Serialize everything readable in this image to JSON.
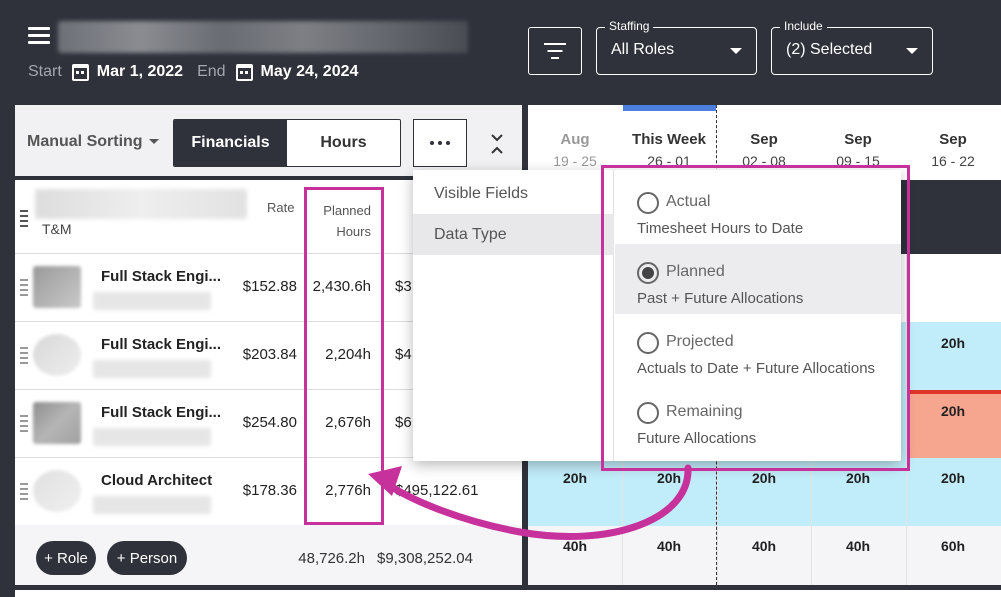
{
  "header": {
    "start_label": "Start",
    "start_date": "Mar 1, 2022",
    "end_label": "End",
    "end_date": "May 24, 2024",
    "staffing_legend": "Staffing",
    "staffing_value": "All Roles",
    "include_legend": "Include",
    "include_value": "(2) Selected",
    "icons": [
      "hamburger-icon",
      "calendar-icon",
      "filter-icon",
      "chevron-down-icon"
    ]
  },
  "toolbar": {
    "sort_label": "Manual Sorting",
    "tabs": [
      {
        "label": "Financials",
        "active": true
      },
      {
        "label": "Hours",
        "active": false
      }
    ],
    "more_icon": "more-horizontal-icon",
    "collapse_icon": "collapse-icon"
  },
  "table": {
    "group_label": "T&M",
    "col_rate": "Rate",
    "col_planned": "Planned",
    "col_hours": "Hours",
    "rows": [
      {
        "role": "Full Stack Engi...",
        "rate": "$152.88",
        "hours": "2,430.6h",
        "cost": "$3"
      },
      {
        "role": "Full Stack Engi...",
        "rate": "$203.84",
        "hours": "2,204h",
        "cost": "$4"
      },
      {
        "role": "Full Stack Engi...",
        "rate": "$254.80",
        "hours": "2,676h",
        "cost": "$6"
      },
      {
        "role": "Cloud Architect",
        "rate": "$178.36",
        "hours": "2,776h",
        "cost": "$495,122.61"
      }
    ],
    "add_role": "+ Role",
    "add_person": "+ Person",
    "total_hours": "48,726.2h",
    "total_cost": "$9,308,252.04"
  },
  "timeline": {
    "weeks": [
      {
        "month": "Aug",
        "days": "19 - 25",
        "past": true
      },
      {
        "month": "This Week",
        "days": "26 - 01",
        "past": false
      },
      {
        "month": "Sep",
        "days": "02 - 08",
        "past": false
      },
      {
        "month": "Sep",
        "days": "09 - 15",
        "past": false
      },
      {
        "month": "Sep",
        "days": "16 - 22",
        "past": false
      }
    ],
    "row2_last": "20h",
    "row3_last": "20h",
    "row4": [
      "20h",
      "20h",
      "20h",
      "20h",
      "20h"
    ],
    "totals": [
      "40h",
      "40h",
      "40h",
      "40h",
      "60h"
    ],
    "colors": {
      "allocation": "#c1ecf9",
      "over": "#f6a58f",
      "over_line": "#e0342b"
    }
  },
  "popup": {
    "menu": [
      {
        "label": "Visible Fields",
        "active": false
      },
      {
        "label": "Data Type",
        "active": true
      }
    ],
    "options": [
      {
        "title": "Actual",
        "sub": "Timesheet Hours to Date",
        "checked": false
      },
      {
        "title": "Planned",
        "sub": "Past + Future Allocations",
        "checked": true
      },
      {
        "title": "Projected",
        "sub": "Actuals to Date + Future Allocations",
        "checked": false
      },
      {
        "title": "Remaining",
        "sub": "Future Allocations",
        "checked": false
      }
    ]
  },
  "highlight_color": "#c7319c"
}
